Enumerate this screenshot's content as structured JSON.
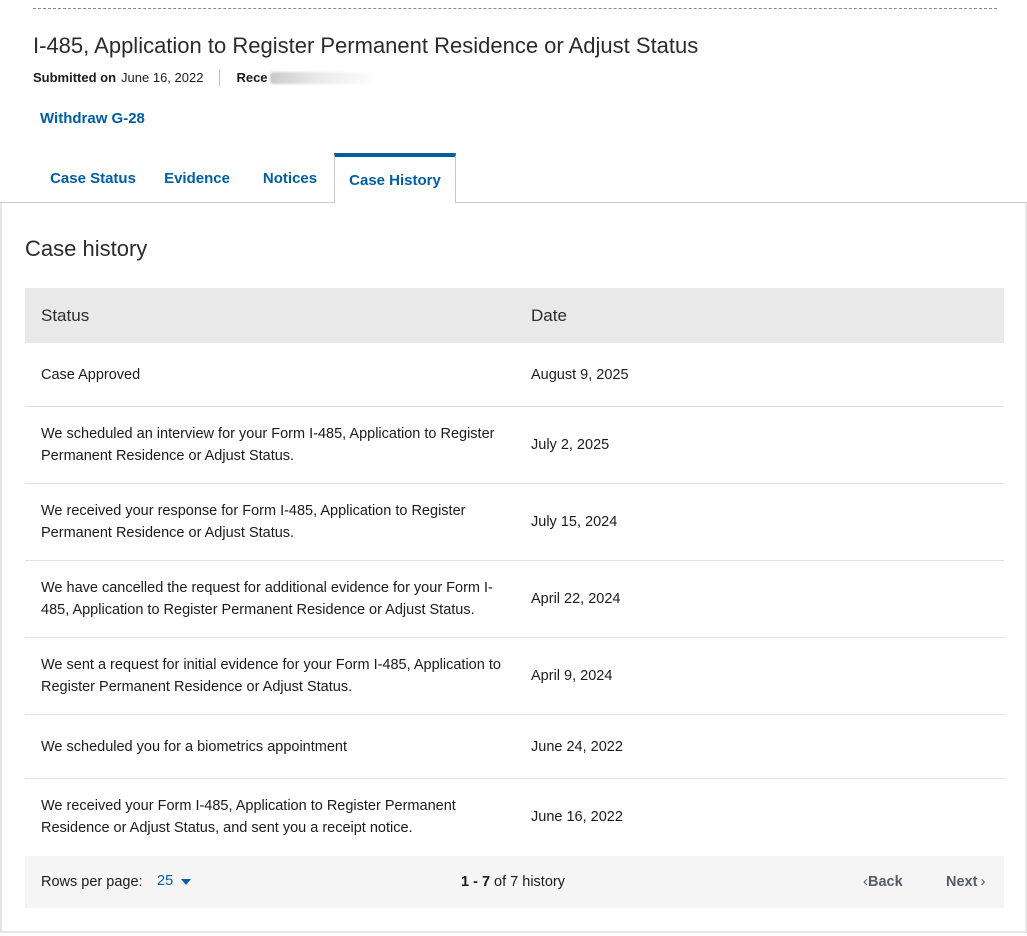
{
  "header": {
    "form_title": "I-485, Application to Register Permanent Residence or Adjust Status",
    "submitted_label": "Submitted on",
    "submitted_value": "June 16, 2022",
    "receipt_label": "Rece"
  },
  "actions": {
    "withdraw_label": "Withdraw G-28"
  },
  "tabs": [
    {
      "label": "Case Status",
      "active": false
    },
    {
      "label": "Evidence",
      "active": false
    },
    {
      "label": "Notices",
      "active": false
    },
    {
      "label": "Case History",
      "active": true
    }
  ],
  "section_title": "Case history",
  "table": {
    "headers": {
      "status": "Status",
      "date": "Date"
    },
    "rows": [
      {
        "status": "Case Approved",
        "date": "August 9, 2025"
      },
      {
        "status": "We scheduled an interview for your Form I-485, Application to Register Permanent Residence or Adjust Status.",
        "date": "July 2, 2025"
      },
      {
        "status": "We received your response for Form I-485, Application to Register Permanent Residence or Adjust Status.",
        "date": "July 15, 2024"
      },
      {
        "status": "We have cancelled the request for additional evidence for your Form I-485, Application to Register Permanent Residence or Adjust Status.",
        "date": "April 22, 2024"
      },
      {
        "status": "We sent a request for initial evidence for your Form I-485, Application to Register Permanent Residence or Adjust Status.",
        "date": "April 9, 2024"
      },
      {
        "status": "We scheduled you for a biometrics appointment",
        "date": "June 24, 2022"
      },
      {
        "status": "We received your Form I-485, Application to Register Permanent Residence or Adjust Status, and sent you a receipt notice.",
        "date": "June 16, 2022"
      }
    ]
  },
  "pagination": {
    "rows_per_page_label": "Rows per page:",
    "rows_per_page_value": "25",
    "range_bold": "1 - 7",
    "range_rest": " of 7 history",
    "back_label": "Back",
    "next_label": "Next"
  },
  "colors": {
    "link": "#005ea2",
    "header_bg": "#e9e9e9",
    "footer_bg": "#f5f5f5"
  }
}
